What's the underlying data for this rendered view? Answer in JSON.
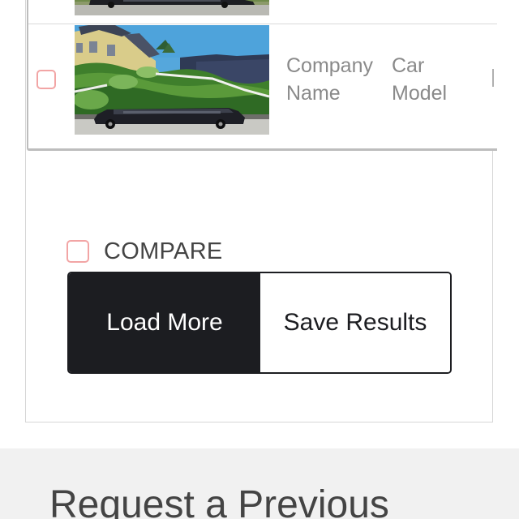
{
  "results": {
    "rows": [
      {
        "image": "limousine-photo",
        "company": "",
        "model": ""
      },
      {
        "image": "limousine-photo",
        "company": "Company Name",
        "model": "Car Model"
      }
    ]
  },
  "compare": {
    "label": "COMPARE"
  },
  "buttons": {
    "load_more": "Load More",
    "save_results": "Save Results"
  },
  "request": {
    "title": "Request a Previous"
  },
  "colors": {
    "dark": "#1c1d21",
    "checkbox_border": "#f2a5a5",
    "section_bg": "#f1f1f1"
  }
}
